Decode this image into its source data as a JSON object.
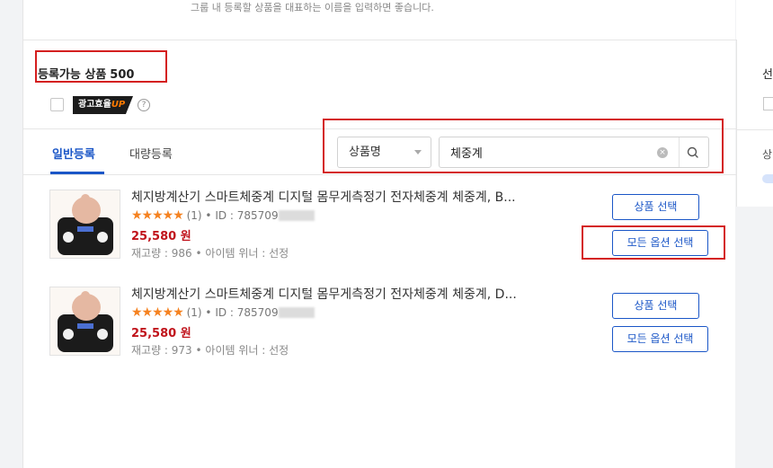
{
  "header": {
    "hint": "그룹 내 등록할 상품을 대표하는 이름을 입력하면 좋습니다."
  },
  "summary": {
    "label": "등록가능 상품",
    "count": "500"
  },
  "ad": {
    "text": "광고효율",
    "up": "UP",
    "help": "?"
  },
  "tabs": [
    {
      "label": "일반등록",
      "active": true
    },
    {
      "label": "대량등록",
      "active": false
    }
  ],
  "search": {
    "field_select": "상품명",
    "query": "체중계",
    "clear": "×"
  },
  "products": [
    {
      "title": "체지방계산기 스마트체중계 디지털 몸무게측정기 전자체중계 체중계, B...",
      "stars": "★★★★★",
      "rating_count": "(1)",
      "id_label": "• ID : 785709",
      "price": "25,580 원",
      "stock": "재고량 : 986 • 아이템 위너 : 선정",
      "select_btn": "상품 선택",
      "all_options_btn": "모든 옵션 선택"
    },
    {
      "title": "체지방계산기 스마트체중계 디지털 몸무게측정기 전자체중계 체중계, D...",
      "stars": "★★★★★",
      "rating_count": "(1)",
      "id_label": "• ID : 785709",
      "price": "25,580 원",
      "stock": "재고량 : 973 • 아이템 위너 : 선정",
      "select_btn": "상품 선택",
      "all_options_btn": "모든 옵션 선택"
    }
  ],
  "right_panel": {
    "letter": "선",
    "text2": "상"
  },
  "colors": {
    "accent": "#1a56c7",
    "price": "#c0131b",
    "highlight": "#d41f1f",
    "stars": "#f58220"
  }
}
